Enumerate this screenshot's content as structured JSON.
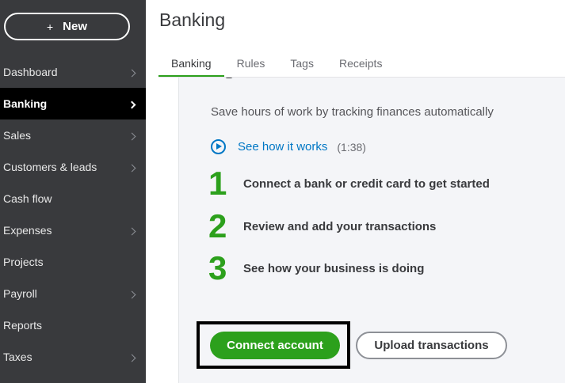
{
  "sidebar": {
    "new_button": {
      "icon": "plus",
      "label": "New"
    },
    "items": [
      {
        "label": "Dashboard",
        "has_chevron": true,
        "active": false
      },
      {
        "label": "Banking",
        "has_chevron": true,
        "active": true
      },
      {
        "label": "Sales",
        "has_chevron": true,
        "active": false
      },
      {
        "label": "Customers & leads",
        "has_chevron": true,
        "active": false
      },
      {
        "label": "Cash flow",
        "has_chevron": false,
        "active": false
      },
      {
        "label": "Expenses",
        "has_chevron": true,
        "active": false
      },
      {
        "label": "Projects",
        "has_chevron": false,
        "active": false
      },
      {
        "label": "Payroll",
        "has_chevron": true,
        "active": false
      },
      {
        "label": "Reports",
        "has_chevron": false,
        "active": false
      },
      {
        "label": "Taxes",
        "has_chevron": true,
        "active": false
      }
    ]
  },
  "header": {
    "title": "Banking",
    "tabs": [
      {
        "label": "Banking",
        "active": true
      },
      {
        "label": "Rules",
        "active": false
      },
      {
        "label": "Tags",
        "active": false
      },
      {
        "label": "Receipts",
        "active": false
      }
    ]
  },
  "main": {
    "subtitle": "Save hours of work by tracking finances automatically",
    "how_it_works": {
      "icon": "play-circle",
      "label": "See how it works",
      "duration": "(1:38)"
    },
    "steps": [
      {
        "number": "1",
        "text": "Connect a bank or credit card to get started"
      },
      {
        "number": "2",
        "text": "Review and add your transactions"
      },
      {
        "number": "3",
        "text": "See how your business is doing"
      }
    ],
    "connect_button": "Connect account",
    "upload_button": "Upload transactions"
  },
  "colors": {
    "sidebar_bg": "#393a3d",
    "accent_green": "#2ca01c",
    "link_blue": "#0077c5",
    "card_bg": "#f4f5f8"
  }
}
